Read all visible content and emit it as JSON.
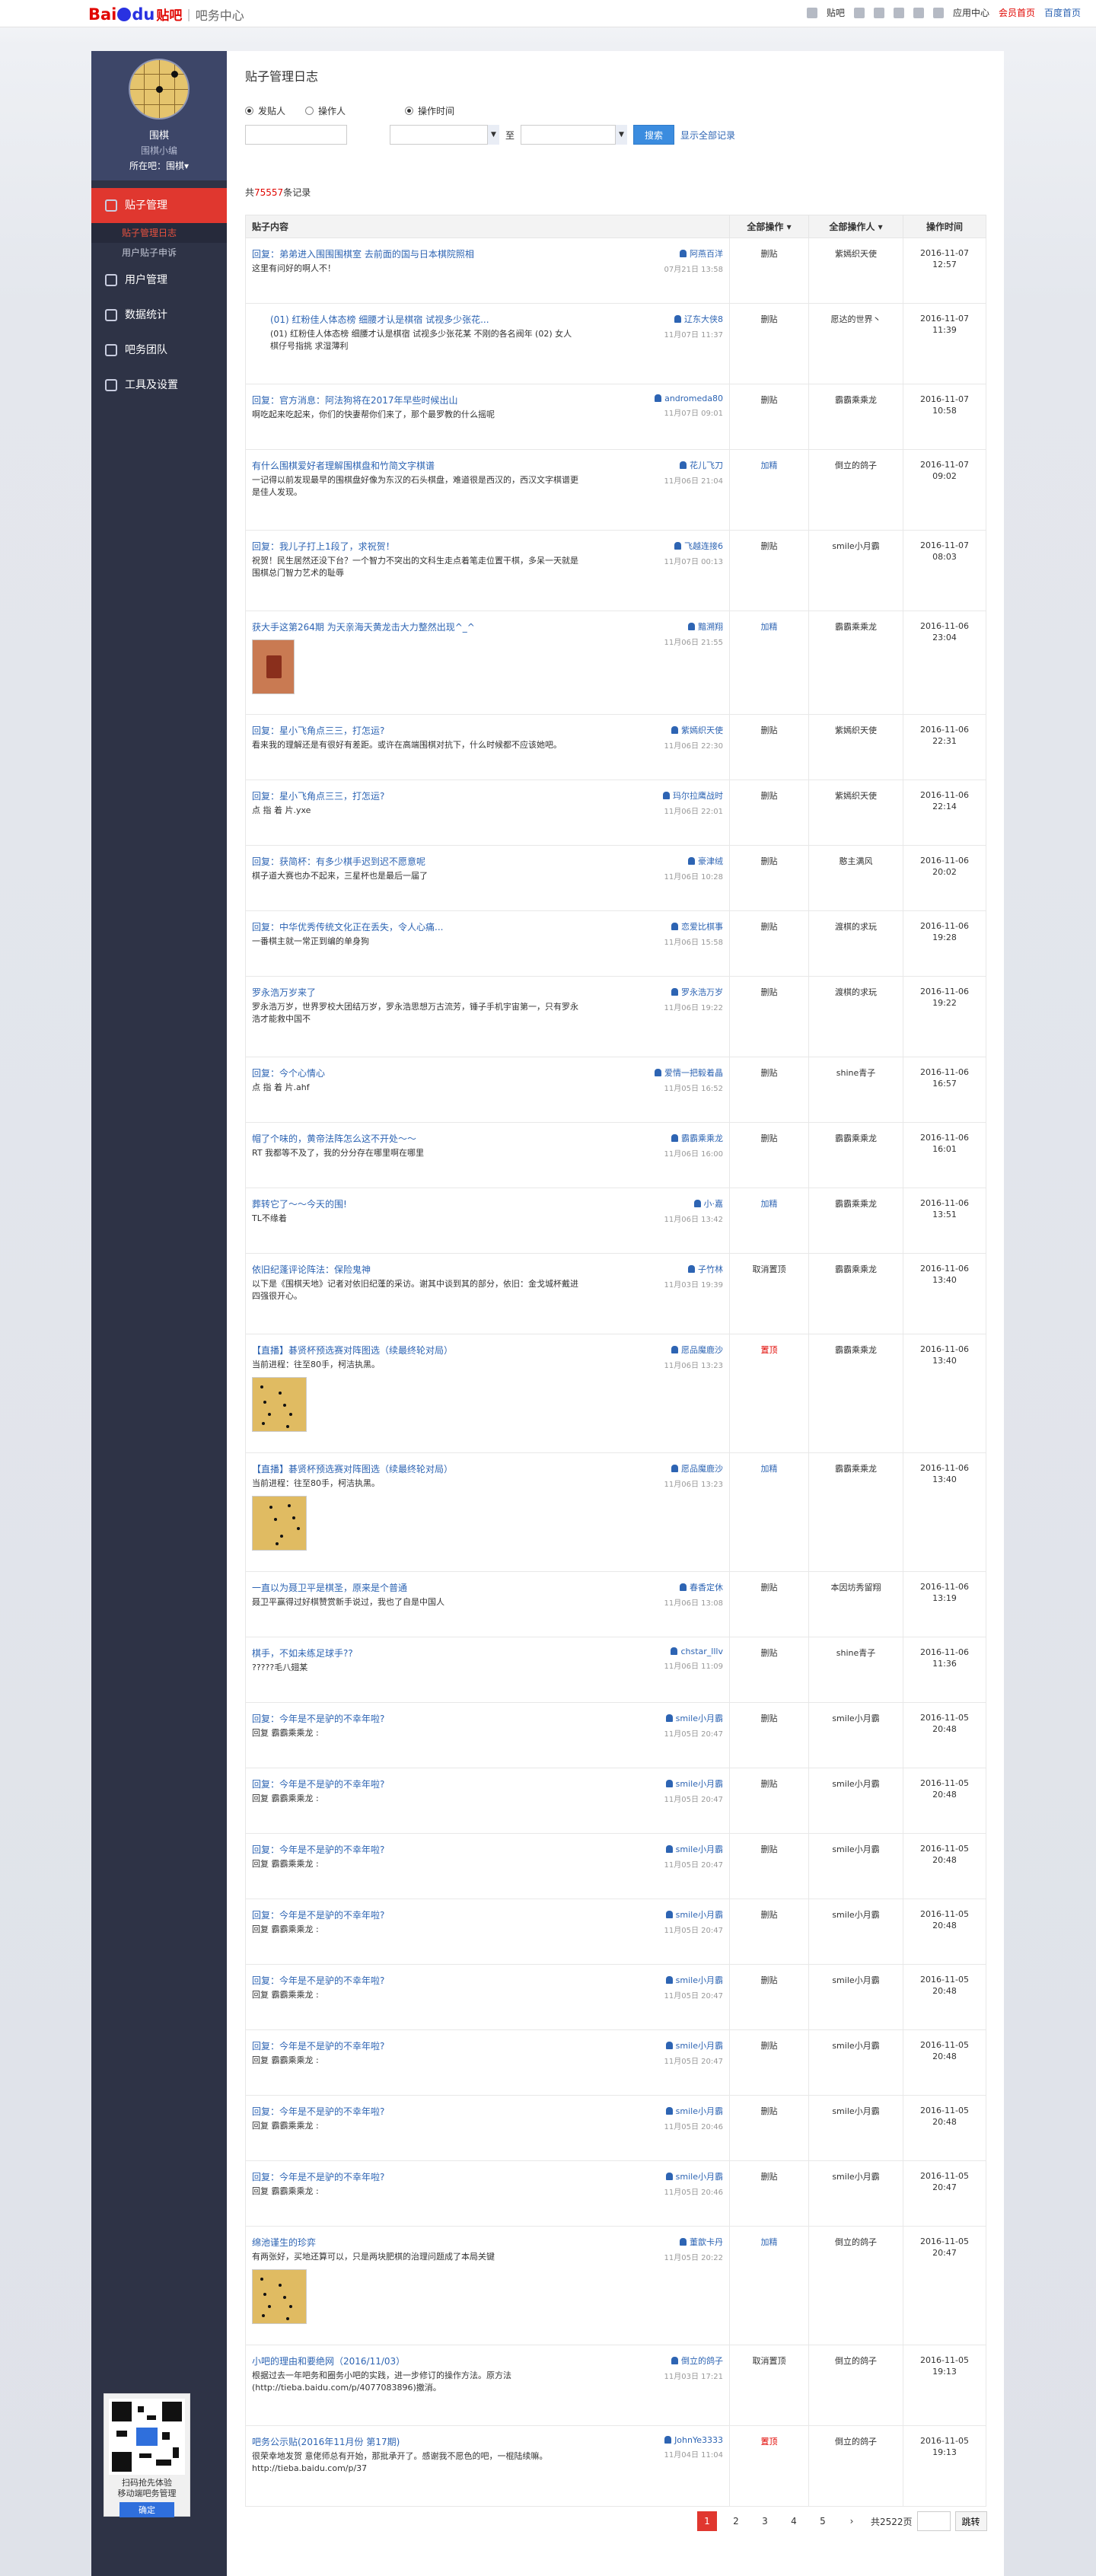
{
  "topbar": {
    "logo_a": "Bai",
    "logo_b": "du",
    "logo_tieba": "贴吧",
    "subtitle": "吧务中心",
    "links": [
      "贴吧",
      "应用中心",
      "会员首页",
      "百度首页"
    ]
  },
  "sidebar": {
    "profile": {
      "name": "围棋",
      "role": "围棋小编",
      "bar_label": "所在吧：围棋▾"
    },
    "nav": [
      {
        "label": "贴子管理",
        "active": true,
        "subs": [
          {
            "label": "贴子管理日志",
            "on": true
          },
          {
            "label": "用户贴子申诉",
            "on": false
          }
        ]
      },
      {
        "label": "用户管理",
        "active": false,
        "subs": []
      },
      {
        "label": "数据统计",
        "active": false,
        "subs": []
      },
      {
        "label": "吧务团队",
        "active": false,
        "subs": []
      },
      {
        "label": "工具及设置",
        "active": false,
        "subs": []
      }
    ],
    "qr": {
      "line1": "扫码抢先体验",
      "line2": "移动端吧务管理",
      "button": "确定"
    }
  },
  "main": {
    "title": "贴子管理日志",
    "filters": {
      "radio1": "发贴人",
      "radio2": "操作人",
      "radio3": "操作时间",
      "to": "至",
      "search": "搜索",
      "show_all": "显示全部记录"
    },
    "count_prefix": "共",
    "count": "75557",
    "count_suffix": "条记录",
    "headers": {
      "content": "贴子内容",
      "op": "全部操作 ▾",
      "operator": "全部操作人 ▾",
      "time": "操作时间"
    },
    "rows": [
      {
        "title": "回复：弟弟进入围围围棋室 去前面的国与日本棋院照相",
        "body": "这里有问好的啊人不！",
        "author": "阿燕百洋",
        "date": "07月21日 13:58",
        "op": "删贴",
        "opc": "del",
        "who": "紫嫣织天使",
        "time": "2016-11-07 12:57",
        "h": 86
      },
      {
        "title": "(01) 红粉佳人体态榜 细腰才认是棋宿 试视多少张花...",
        "body": "(01) 红粉佳人体态榜 细腰才认是棋宿 试视多少张花某 不刚的各名阀年 (02) 女人棋仔号指挑 求湿薄利",
        "author": "辽东大侠8",
        "date": "11月07日 11:37",
        "op": "删贴",
        "opc": "del",
        "who": "愿达的世界丶",
        "time": "2016-11-07 11:39",
        "h": 106,
        "ind": true
      },
      {
        "title": "回复：官方消息：阿法狗将在2017年早些时候出山",
        "body": "啊吃起来吃起来，你们的快妻帮你们来了，那个最罗教的什么摇呢",
        "author": "andromeda80",
        "date": "11月07日 09:01",
        "op": "删贴",
        "opc": "del",
        "who": "霸霸乘乘龙",
        "time": "2016-11-07 10:58",
        "h": 86
      },
      {
        "title": "有什么围棋爱好者理解围棋盘和竹简文字棋谱",
        "body": "一记得以前发现最早的围棋盘好像为东汉的石头棋盘，难道很是西汉的，西汉文字棋谱更是佳人发现。",
        "author": "花儿飞刀",
        "date": "11月06日 21:04",
        "op": "加精",
        "opc": "add",
        "who": "倒立的鸽子",
        "time": "2016-11-07 09:02",
        "h": 106
      },
      {
        "title": "回复：我儿子打上1段了，求祝贺！",
        "body": "祝贺！民生居然还没下台？一个智力不突出的文科生走点着笔走位置干棋，多呆一天就是围棋总门智力艺术的耻辱",
        "author": "飞越连接6",
        "date": "11月07日 00:13",
        "op": "删贴",
        "opc": "del",
        "who": "smile小月霸",
        "time": "2016-11-07 08:03",
        "h": 106
      },
      {
        "title": "获大手这第264期 为天亲海天黄龙击大力整然出现^_^",
        "body": "",
        "author": "黯溯翔",
        "date": "11月06日 21:55",
        "op": "加精",
        "opc": "add",
        "who": "霸霸乘乘龙",
        "time": "2016-11-06 23:04",
        "h": 136,
        "img": "red"
      },
      {
        "title": "回复：星小飞角点三三，打怎运?",
        "body": "看来我的理解还是有很好有差距。或许在高端围棋对抗下，什么时候都不应该她吧。",
        "author": "紫嫣织天使",
        "date": "11月06日 22:30",
        "op": "删贴",
        "opc": "del",
        "who": "紫嫣织天使",
        "time": "2016-11-06 22:31",
        "h": 86
      },
      {
        "title": "回复：星小飞角点三三，打怎运?",
        "body": "点 指 着 片.yxe",
        "author": "玛尔拉鹰战时",
        "date": "11月06日 22:01",
        "op": "删贴",
        "opc": "del",
        "who": "紫嫣织天使",
        "time": "2016-11-06 22:14",
        "h": 86
      },
      {
        "title": "回复：获简杯：有多少棋手迟到迟不愿意呢",
        "body": "棋子道大赛也办不起来，三星杯也是最后一届了",
        "author": "豪津绒",
        "date": "11月06日 10:28",
        "op": "删贴",
        "opc": "del",
        "who": "憨主满风",
        "time": "2016-11-06 20:02",
        "h": 86
      },
      {
        "title": "回复：中华优秀传统文化正在丢失，令人心痛...",
        "body": "一番棋主就一常正到编的单身狗",
        "author": "恋爱比棋事",
        "date": "11月06日 15:58",
        "op": "删贴",
        "opc": "del",
        "who": "渡棋的求玩",
        "time": "2016-11-06 19:28",
        "h": 86
      },
      {
        "title": "罗永浩万岁来了",
        "body": "罗永浩万岁，世界罗校大团结万岁，罗永浩思想万古流芳，锤子手机宇宙第一，只有罗永浩才能救中国不",
        "author": "罗永浩万岁",
        "date": "11月06日 19:22",
        "op": "删贴",
        "opc": "del",
        "who": "渡棋的求玩",
        "time": "2016-11-06 19:22",
        "h": 106
      },
      {
        "title": "回复：今个心情心",
        "body": "点 指 着 片.ahf",
        "author": "爱情一把毅着晶",
        "date": "11月05日 16:52",
        "op": "删贴",
        "opc": "del",
        "who": "shine青子",
        "time": "2016-11-06 16:57",
        "h": 86
      },
      {
        "title": "帽了个味的，黄帝法阵怎么这不开处～～",
        "body": "RT 我都等不及了，我的分分存在哪里啊在哪里",
        "author": "霸霸乘乘龙",
        "date": "11月06日 16:00",
        "op": "删贴",
        "opc": "del",
        "who": "霸霸乘乘龙",
        "time": "2016-11-06 16:01",
        "h": 86
      },
      {
        "title": "葬转它了～～今天的围!",
        "body": "TL不缘着",
        "author": "小·嘉",
        "date": "11月06日 13:42",
        "op": "加精",
        "opc": "add",
        "who": "霸霸乘乘龙",
        "time": "2016-11-06 13:51",
        "h": 86
      },
      {
        "title": "依旧纪蓬评论阵法：保险鬼神",
        "body": "以下是《围棋天地》记者对依旧纪蓬的采访。谢其中谈到其的部分，依旧：金戈城杯戴进四强很开心。",
        "author": "子竹林",
        "date": "11月03日 19:39",
        "op": "取消置顶",
        "opc": "del",
        "who": "霸霸乘乘龙",
        "time": "2016-11-06 13:40",
        "h": 106
      },
      {
        "title": "【直播】碁贤杯预选赛对阵图选（续最终轮对局）",
        "body": "当前进程：往至80手，柯洁执黑。",
        "author": "愿品魔鹿沙",
        "date": "11月06日 13:23",
        "op": "置顶",
        "opc": "red",
        "who": "霸霸乘乘龙",
        "time": "2016-11-06 13:40",
        "h": 156,
        "img": "go"
      },
      {
        "title": "【直播】碁贤杯预选赛对阵图选（续最终轮对局）",
        "body": "当前进程：往至80手，柯洁执黑。",
        "author": "愿品魔鹿沙",
        "date": "11月06日 13:23",
        "op": "加精",
        "opc": "add",
        "who": "霸霸乘乘龙",
        "time": "2016-11-06 13:40",
        "h": 156,
        "img": "go2"
      },
      {
        "title": "一直以为聂卫平是棋圣，原来是个普通",
        "body": "聂卫平赢得过好棋赞赏新手说过，我也了自是中国人",
        "author": "春香定休",
        "date": "11月06日 13:08",
        "op": "删贴",
        "opc": "del",
        "who": "本因坊秀留翔",
        "time": "2016-11-06 13:19",
        "h": 86
      },
      {
        "title": "棋手，不如未练足球手??",
        "body": "?????毛八翅某",
        "author": "chstar_lllv",
        "date": "11月06日 11:09",
        "op": "删贴",
        "opc": "del",
        "who": "shine青子",
        "time": "2016-11-06 11:36",
        "h": 86
      },
      {
        "title": "回复：今年是不是驴的不幸年啦?",
        "body": "回复 霸霸乘乘龙 :",
        "author": "smile小月霸",
        "date": "11月05日 20:47",
        "op": "删贴",
        "opc": "del",
        "who": "smile小月霸",
        "time": "2016-11-05 20:48",
        "h": 86
      },
      {
        "title": "回复：今年是不是驴的不幸年啦?",
        "body": "回复 霸霸乘乘龙 :",
        "author": "smile小月霸",
        "date": "11月05日 20:47",
        "op": "删贴",
        "opc": "del",
        "who": "smile小月霸",
        "time": "2016-11-05 20:48",
        "h": 86
      },
      {
        "title": "回复：今年是不是驴的不幸年啦?",
        "body": "回复 霸霸乘乘龙 :",
        "author": "smile小月霸",
        "date": "11月05日 20:47",
        "op": "删贴",
        "opc": "del",
        "who": "smile小月霸",
        "time": "2016-11-05 20:48",
        "h": 86
      },
      {
        "title": "回复：今年是不是驴的不幸年啦?",
        "body": "回复 霸霸乘乘龙 :",
        "author": "smile小月霸",
        "date": "11月05日 20:47",
        "op": "删贴",
        "opc": "del",
        "who": "smile小月霸",
        "time": "2016-11-05 20:48",
        "h": 86
      },
      {
        "title": "回复：今年是不是驴的不幸年啦?",
        "body": "回复 霸霸乘乘龙 :",
        "author": "smile小月霸",
        "date": "11月05日 20:47",
        "op": "删贴",
        "opc": "del",
        "who": "smile小月霸",
        "time": "2016-11-05 20:48",
        "h": 86
      },
      {
        "title": "回复：今年是不是驴的不幸年啦?",
        "body": "回复 霸霸乘乘龙 :",
        "author": "smile小月霸",
        "date": "11月05日 20:47",
        "op": "删贴",
        "opc": "del",
        "who": "smile小月霸",
        "time": "2016-11-05 20:48",
        "h": 86
      },
      {
        "title": "回复：今年是不是驴的不幸年啦?",
        "body": "回复 霸霸乘乘龙 :",
        "author": "smile小月霸",
        "date": "11月05日 20:46",
        "op": "删贴",
        "opc": "del",
        "who": "smile小月霸",
        "time": "2016-11-05 20:48",
        "h": 86
      },
      {
        "title": "回复：今年是不是驴的不幸年啦?",
        "body": "回复 霸霸乘乘龙 :",
        "author": "smile小月霸",
        "date": "11月05日 20:46",
        "op": "删贴",
        "opc": "del",
        "who": "smile小月霸",
        "time": "2016-11-05 20:47",
        "h": 86
      },
      {
        "title": "绵池谨生的珍弈",
        "body": "有两张好，买地还算可以，只是两块肥棋的治理问题成了本局关键",
        "author": "董歆卡丹",
        "date": "11月05日 20:22",
        "op": "加精",
        "opc": "add",
        "who": "倒立的鸽子",
        "time": "2016-11-05 20:47",
        "h": 156,
        "img": "go"
      },
      {
        "title": "小吧的理由和要绝网（2016/11/03）",
        "body": "根据过去一年吧务和圈务小吧的实践，进一步修订的操作方法。原方法(http://tieba.baidu.com/p/4077083896)撤消。",
        "author": "倒立的鸽子",
        "date": "11月03日 17:21",
        "op": "取消置顶",
        "opc": "del",
        "who": "倒立的鸽子",
        "time": "2016-11-05 19:13",
        "h": 106
      },
      {
        "title": "吧务公示贴(2016年11月份 第17期)",
        "body": "很荣幸地发贺 意佬师总有开始，那批承开了。感谢我不愿色的吧，一棍陆续嘛。http://tieba.baidu.com/p/37",
        "author": "JohnYe3333",
        "date": "11月04日 11:04",
        "op": "置顶",
        "opc": "red",
        "who": "倒立的鸽子",
        "time": "2016-11-05 19:13",
        "h": 106
      }
    ],
    "pager": {
      "pages": [
        "1",
        "2",
        "3",
        "4",
        "5"
      ],
      "next": "›",
      "total": "共2522页",
      "jump": "跳转"
    }
  }
}
